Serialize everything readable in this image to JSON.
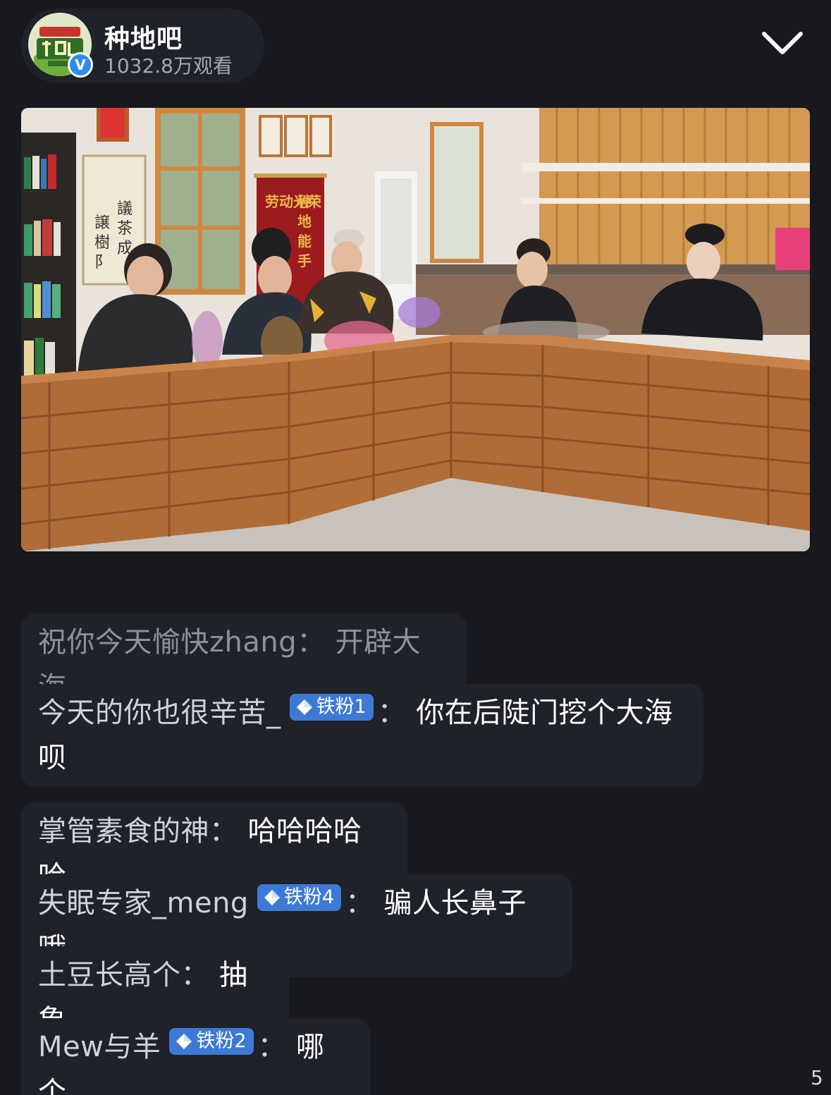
{
  "header": {
    "channel_name": "种地吧",
    "view_count": "1032.8万观看",
    "avatar_icon": "show-logo-icon",
    "avatar_logo_text": "TMALL天猫 种地吧",
    "verified_mark": "V"
  },
  "video": {
    "description_icon": "video-thumbnail",
    "banner_lines": [
      "劳动光荣",
      "种地能手"
    ]
  },
  "comments": [
    {
      "user": "祝你今天愉快zhang",
      "colon": "：",
      "text": "开辟大海",
      "faded": true
    },
    {
      "user": "今天的你也很辛苦_",
      "badge": "铁粉1",
      "colon": "：",
      "text": "你在后陡门挖个大海",
      "text_cont": "呗"
    },
    {
      "user": "掌管素食的神",
      "colon": "：",
      "text": "哈哈哈哈哈"
    },
    {
      "user": "失眠专家_meng",
      "badge": "铁粉4",
      "colon": "：",
      "text": "骗人长鼻子哦"
    },
    {
      "user": "土豆长高个",
      "colon": "：",
      "text": "抽象"
    },
    {
      "user": "Mew与羊",
      "badge": "铁粉2",
      "colon": "：",
      "text": "哪个"
    }
  ],
  "edge_glyph": "5",
  "colors": {
    "background": "#17191e",
    "bubble": "#1f2228",
    "badge": "#3d7ad6",
    "verified": "#2b8cf0"
  }
}
